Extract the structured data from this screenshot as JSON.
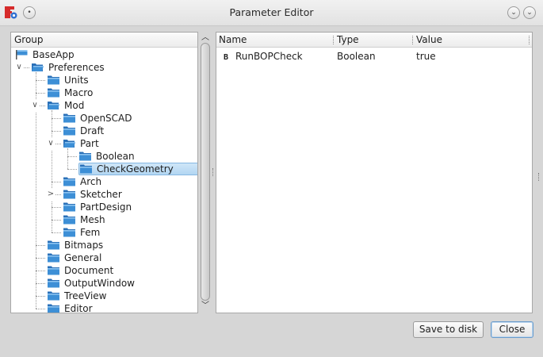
{
  "window": {
    "title": "Parameter Editor",
    "menu_icon": "window-menu-icon",
    "minimize_icon": "chevron-down-icon",
    "close_icon": "chevron-down-circle-icon"
  },
  "group_panel": {
    "header": "Group",
    "tree": [
      {
        "label": "BaseApp",
        "depth": 0,
        "icon": "blue-flag-icon"
      },
      {
        "label": "Preferences",
        "depth": 1,
        "icon": "folder-open-icon",
        "expanded": true
      },
      {
        "label": "Units",
        "depth": 2,
        "icon": "folder-icon"
      },
      {
        "label": "Macro",
        "depth": 2,
        "icon": "folder-icon"
      },
      {
        "label": "Mod",
        "depth": 2,
        "icon": "folder-open-icon",
        "expanded": true
      },
      {
        "label": "OpenSCAD",
        "depth": 3,
        "icon": "folder-icon"
      },
      {
        "label": "Draft",
        "depth": 3,
        "icon": "folder-icon"
      },
      {
        "label": "Part",
        "depth": 3,
        "icon": "folder-open-icon",
        "expanded": true
      },
      {
        "label": "Boolean",
        "depth": 4,
        "icon": "folder-icon"
      },
      {
        "label": "CheckGeometry",
        "depth": 4,
        "icon": "folder-icon",
        "selected": true
      },
      {
        "label": "Arch",
        "depth": 3,
        "icon": "folder-icon"
      },
      {
        "label": "Sketcher",
        "depth": 3,
        "icon": "folder-icon",
        "collapsed_children": true
      },
      {
        "label": "PartDesign",
        "depth": 3,
        "icon": "folder-icon"
      },
      {
        "label": "Mesh",
        "depth": 3,
        "icon": "folder-icon"
      },
      {
        "label": "Fem",
        "depth": 3,
        "icon": "folder-icon"
      },
      {
        "label": "Bitmaps",
        "depth": 2,
        "icon": "folder-icon"
      },
      {
        "label": "General",
        "depth": 2,
        "icon": "folder-icon"
      },
      {
        "label": "Document",
        "depth": 2,
        "icon": "folder-icon"
      },
      {
        "label": "OutputWindow",
        "depth": 2,
        "icon": "folder-icon"
      },
      {
        "label": "TreeView",
        "depth": 2,
        "icon": "folder-icon"
      },
      {
        "label": "Editor",
        "depth": 2,
        "icon": "folder-icon"
      }
    ]
  },
  "parameters_panel": {
    "columns": [
      "Name",
      "Type",
      "Value"
    ],
    "rows": [
      {
        "glyph": "B",
        "name": "RunBOPCheck",
        "type": "Boolean",
        "value": "true"
      }
    ]
  },
  "buttons": {
    "save": "Save to disk",
    "close": "Close"
  },
  "colors": {
    "selection": "#b2d6f2",
    "folder": "#3d8fd6",
    "background": "#d6d6d6"
  }
}
